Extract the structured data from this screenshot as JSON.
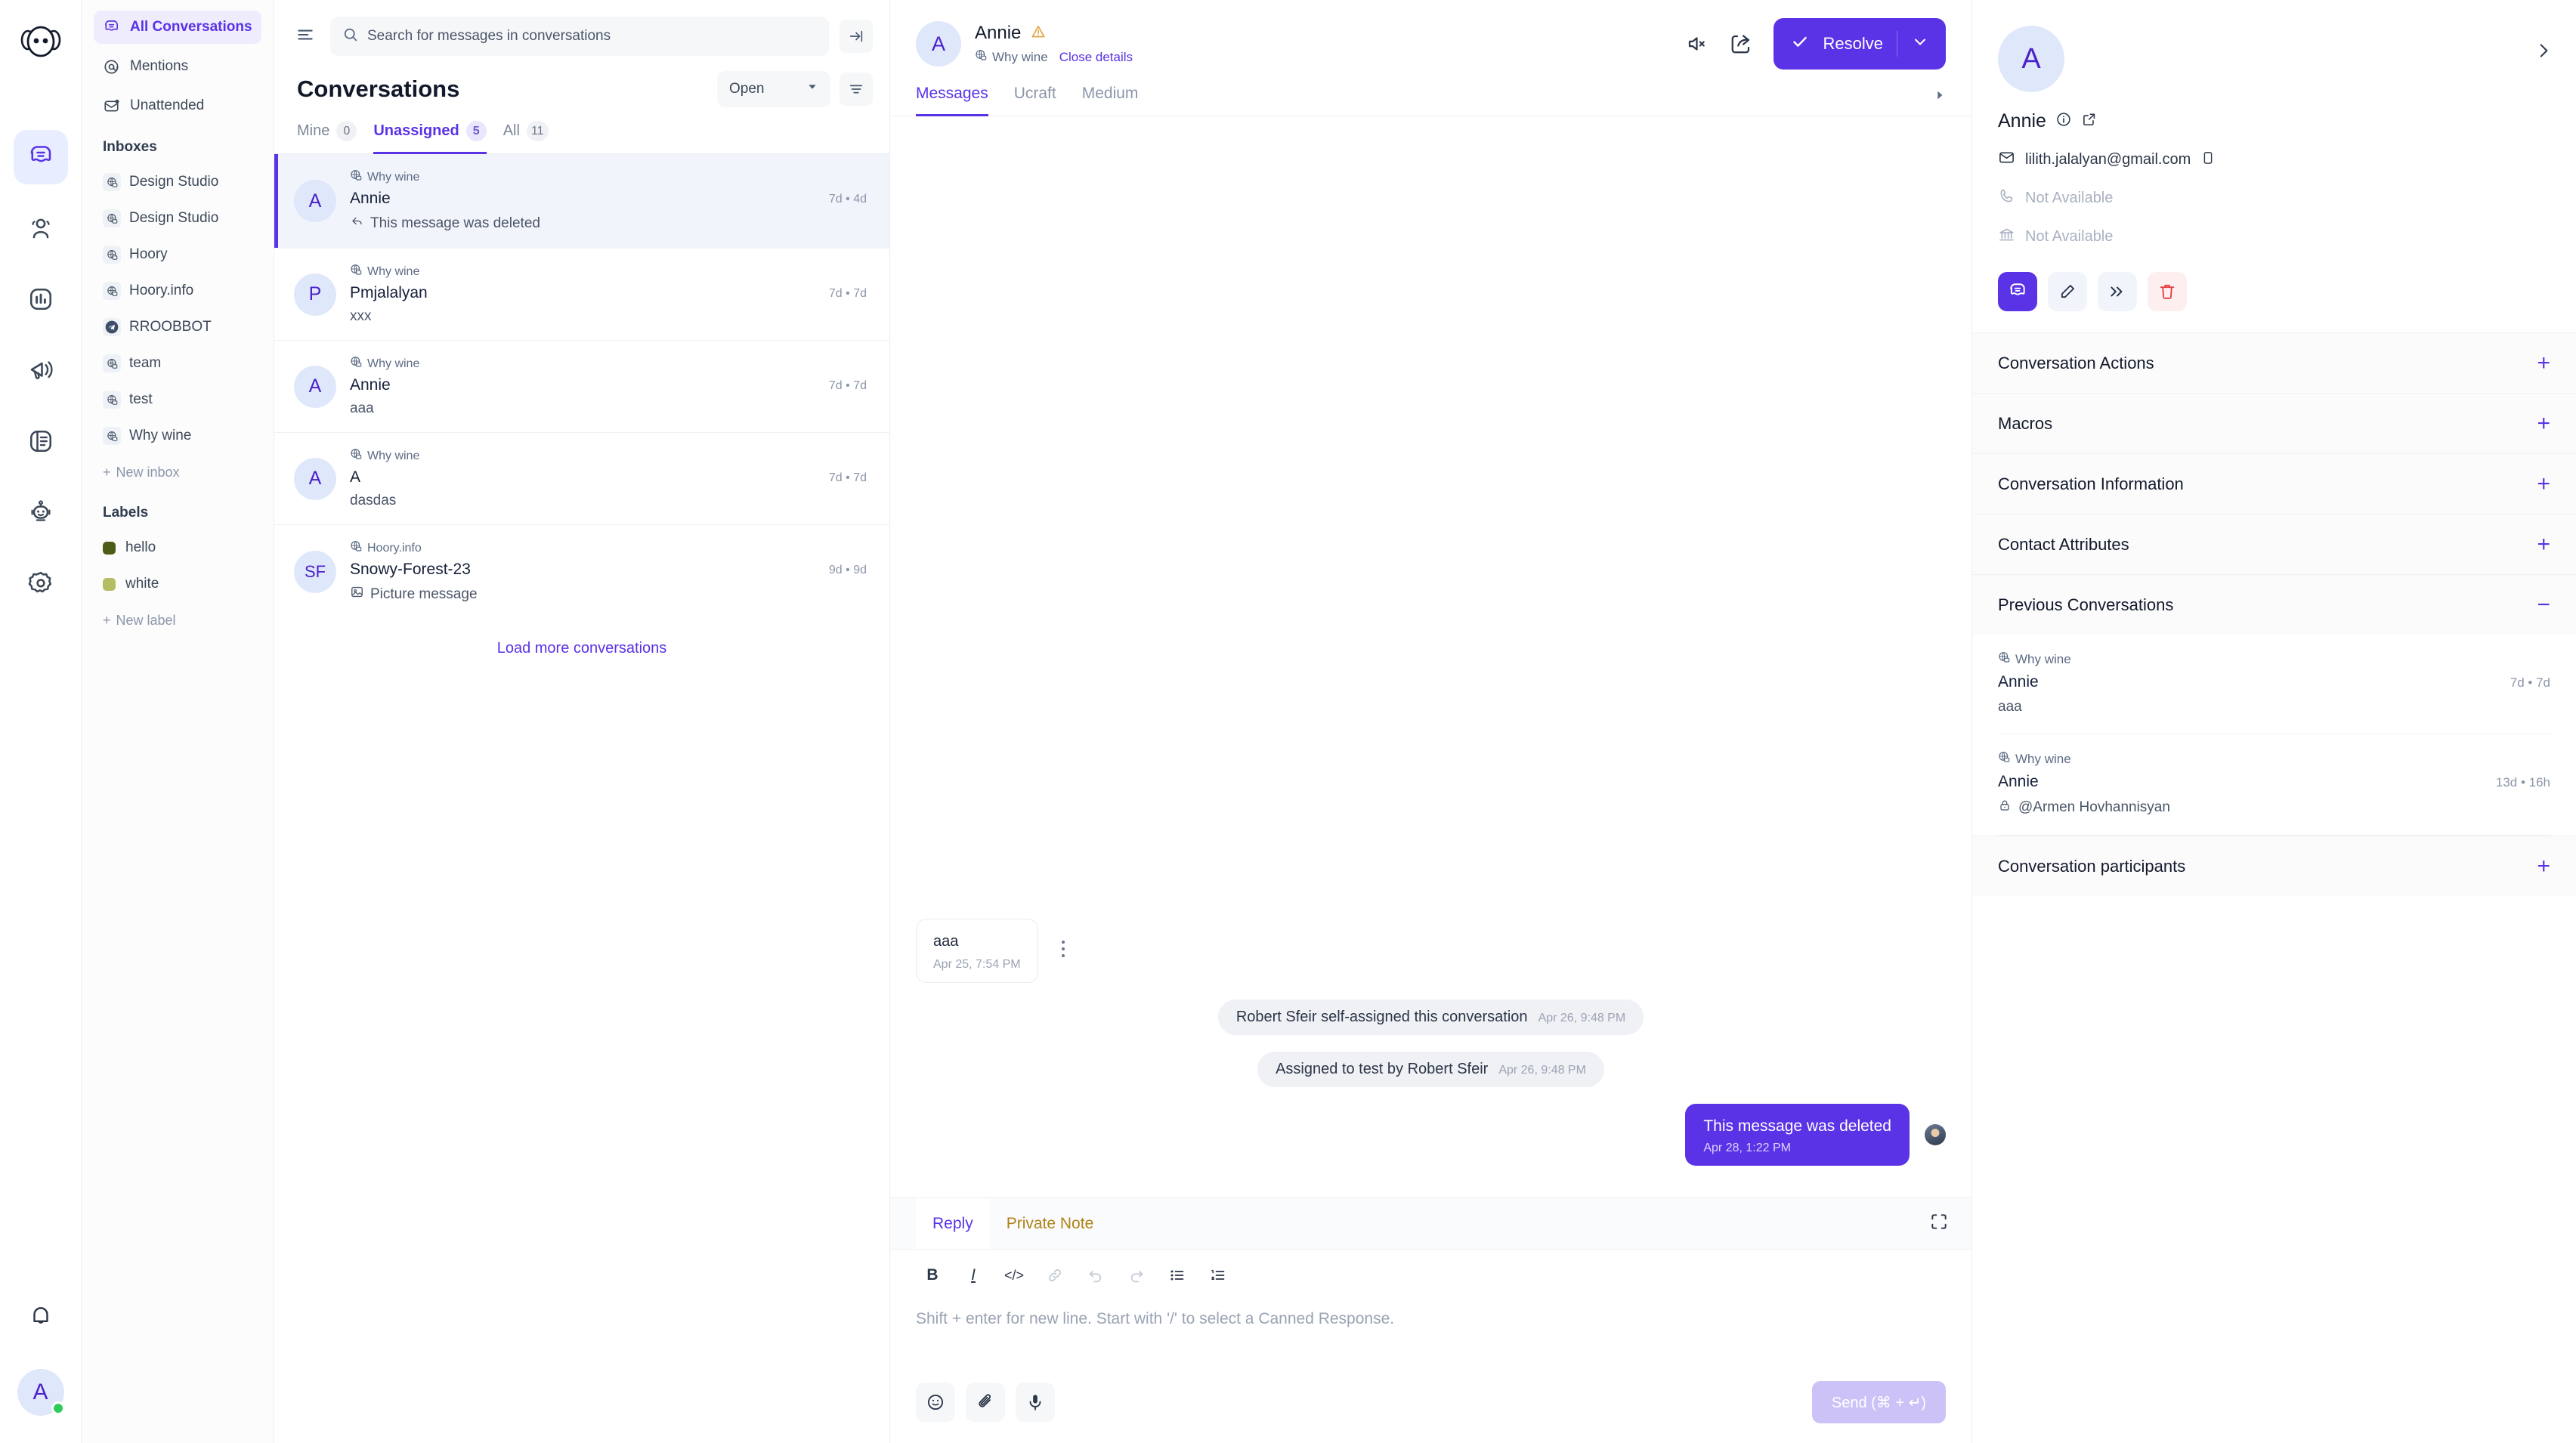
{
  "colors": {
    "primary": "#5a33e6",
    "note_amber": "#b08319",
    "danger": "#e53e3e",
    "online": "#2ecc5a",
    "label_hello": "#4b5d16",
    "label_white": "#b4bd63"
  },
  "rail": {
    "logo_name": "hoory-logo",
    "items": [
      {
        "icon": "conversations-icon",
        "name": "rail-item-conversations",
        "active": true
      },
      {
        "icon": "contacts-icon",
        "name": "rail-item-contacts",
        "active": false
      },
      {
        "icon": "reports-icon",
        "name": "rail-item-reports",
        "active": false
      },
      {
        "icon": "campaigns-icon",
        "name": "rail-item-campaigns",
        "active": false
      },
      {
        "icon": "knowledge-base-icon",
        "name": "rail-item-knowledge-base",
        "active": false
      },
      {
        "icon": "bot-icon",
        "name": "rail-item-bot",
        "active": false
      },
      {
        "icon": "settings-icon",
        "name": "rail-item-settings",
        "active": false
      }
    ],
    "notifications_icon": "bell-icon",
    "avatar_initial": "A"
  },
  "sidebar": {
    "nav": [
      {
        "label": "All Conversations",
        "icon": "conversations-icon",
        "active": true
      },
      {
        "label": "Mentions",
        "icon": "at-mention-icon",
        "active": false
      },
      {
        "label": "Unattended",
        "icon": "unattended-envelope-icon",
        "active": false
      }
    ],
    "inboxes_heading": "Inboxes",
    "inboxes": [
      {
        "label": "Design Studio",
        "icon": "website-globe-icon"
      },
      {
        "label": "Design Studio",
        "icon": "website-globe-icon"
      },
      {
        "label": "Hoory",
        "icon": "website-globe-icon"
      },
      {
        "label": "Hoory.info",
        "icon": "website-globe-icon"
      },
      {
        "label": "RROOBBOT",
        "icon": "telegram-icon"
      },
      {
        "label": "team",
        "icon": "website-globe-icon"
      },
      {
        "label": "test",
        "icon": "website-globe-icon"
      },
      {
        "label": "Why wine",
        "icon": "website-globe-icon"
      }
    ],
    "new_inbox_label": "New inbox",
    "labels_heading": "Labels",
    "labels": [
      {
        "label": "hello",
        "color": "#4b5d16"
      },
      {
        "label": "white",
        "color": "#b4bd63"
      }
    ],
    "new_label_label": "New label"
  },
  "conversation_list": {
    "search_placeholder": "Search for messages in conversations",
    "search_value": "",
    "title": "Conversations",
    "status_filter": "Open",
    "tabs": [
      {
        "label": "Mine",
        "count": "0",
        "active": false
      },
      {
        "label": "Unassigned",
        "count": "5",
        "active": true
      },
      {
        "label": "All",
        "count": "11",
        "active": false
      }
    ],
    "items": [
      {
        "inbox": "Why wine",
        "initial": "A",
        "name": "Annie",
        "preview": "This message was deleted",
        "preview_icon": "reply-arrow-icon",
        "time": "7d • 4d",
        "selected": true
      },
      {
        "inbox": "Why wine",
        "initial": "P",
        "name": "Pmjalalyan",
        "preview": "xxx",
        "preview_icon": "",
        "time": "7d • 7d",
        "selected": false
      },
      {
        "inbox": "Why wine",
        "initial": "A",
        "name": "Annie",
        "preview": "aaa",
        "preview_icon": "",
        "time": "7d • 7d",
        "selected": false
      },
      {
        "inbox": "Why wine",
        "initial": "A",
        "name": "A",
        "preview": "dasdas",
        "preview_icon": "",
        "time": "7d • 7d",
        "selected": false
      },
      {
        "inbox": "Hoory.info",
        "initial": "SF",
        "name": "Snowy-Forest-23",
        "preview": "Picture message",
        "preview_icon": "picture-icon",
        "time": "9d • 9d",
        "selected": false
      }
    ],
    "load_more_label": "Load more conversations"
  },
  "main": {
    "contact_name": "Annie",
    "contact_initial": "A",
    "warning_icon": "warning-triangle-icon",
    "inbox": "Why wine",
    "close_details_label": "Close details",
    "mute_icon": "mute-icon",
    "share_icon": "share-icon",
    "resolve_label": "Resolve",
    "tabs": [
      {
        "label": "Messages",
        "active": true
      },
      {
        "label": "Ucraft",
        "active": false
      },
      {
        "label": "Medium",
        "active": false
      }
    ],
    "messages": [
      {
        "kind": "incoming",
        "text": "aaa",
        "time": "Apr 25, 7:54 PM"
      },
      {
        "kind": "system",
        "text": "Robert Sfeir self-assigned this conversation",
        "time": "Apr 26, 9:48 PM"
      },
      {
        "kind": "system",
        "text": "Assigned to test by Robert Sfeir",
        "time": "Apr 26, 9:48 PM"
      },
      {
        "kind": "outgoing",
        "text": "This message was deleted",
        "time": "Apr 28, 1:22 PM"
      }
    ]
  },
  "composer": {
    "tabs": [
      {
        "label": "Reply",
        "active": true
      },
      {
        "label": "Private Note",
        "active": false
      }
    ],
    "expand_icon": "expand-icon",
    "toolbar": [
      {
        "name": "bold-button",
        "glyph": "B",
        "dim": false
      },
      {
        "name": "italic-button",
        "glyph": "I",
        "dim": false
      },
      {
        "name": "code-button",
        "glyph": "</>",
        "dim": false
      },
      {
        "name": "link-button",
        "glyph": "link",
        "dim": true
      },
      {
        "name": "undo-button",
        "glyph": "undo",
        "dim": true
      },
      {
        "name": "redo-button",
        "glyph": "redo",
        "dim": true
      },
      {
        "name": "bullet-list-button",
        "glyph": "ul",
        "dim": false
      },
      {
        "name": "ordered-list-button",
        "glyph": "ol",
        "dim": false
      }
    ],
    "placeholder": "Shift + enter for new line. Start with '/' to select a Canned Response.",
    "value": "",
    "emoji_icon": "emoji-icon",
    "attach_icon": "attachment-icon",
    "mic_icon": "microphone-icon",
    "send_label": "Send (⌘ + ↵)"
  },
  "right_panel": {
    "avatar_initial": "A",
    "name": "Annie",
    "info_icon": "info-icon",
    "external_icon": "external-link-icon",
    "email": "lilith.jalalyan@gmail.com",
    "email_icon": "envelope-icon",
    "copy_icon": "copy-icon",
    "phone": "Not Available",
    "phone_icon": "phone-icon",
    "company": "Not Available",
    "company_icon": "company-icon",
    "actions": [
      {
        "name": "conversation-action-button",
        "icon": "conversations-icon",
        "style": "primary"
      },
      {
        "name": "edit-contact-button",
        "icon": "pencil-icon",
        "style": "plain"
      },
      {
        "name": "merge-contact-button",
        "icon": "merge-icon",
        "style": "plain"
      },
      {
        "name": "delete-contact-button",
        "icon": "trash-icon",
        "style": "danger"
      }
    ],
    "sections": [
      {
        "title": "Conversation Actions",
        "expanded": false,
        "sign": "+"
      },
      {
        "title": "Macros",
        "expanded": false,
        "sign": "+"
      },
      {
        "title": "Conversation Information",
        "expanded": false,
        "sign": "+"
      },
      {
        "title": "Contact Attributes",
        "expanded": false,
        "sign": "+"
      },
      {
        "title": "Previous Conversations",
        "expanded": true,
        "sign": "−"
      }
    ],
    "previous_conversations": [
      {
        "inbox": "Why wine",
        "name": "Annie",
        "preview": "aaa",
        "preview_icon": "",
        "time": "7d • 7d"
      },
      {
        "inbox": "Why wine",
        "name": "Annie",
        "preview": "@Armen Hovhannisyan",
        "preview_icon": "lock-icon",
        "time": "13d • 16h"
      }
    ],
    "participants_section": {
      "title": "Conversation participants",
      "sign": "+"
    }
  }
}
